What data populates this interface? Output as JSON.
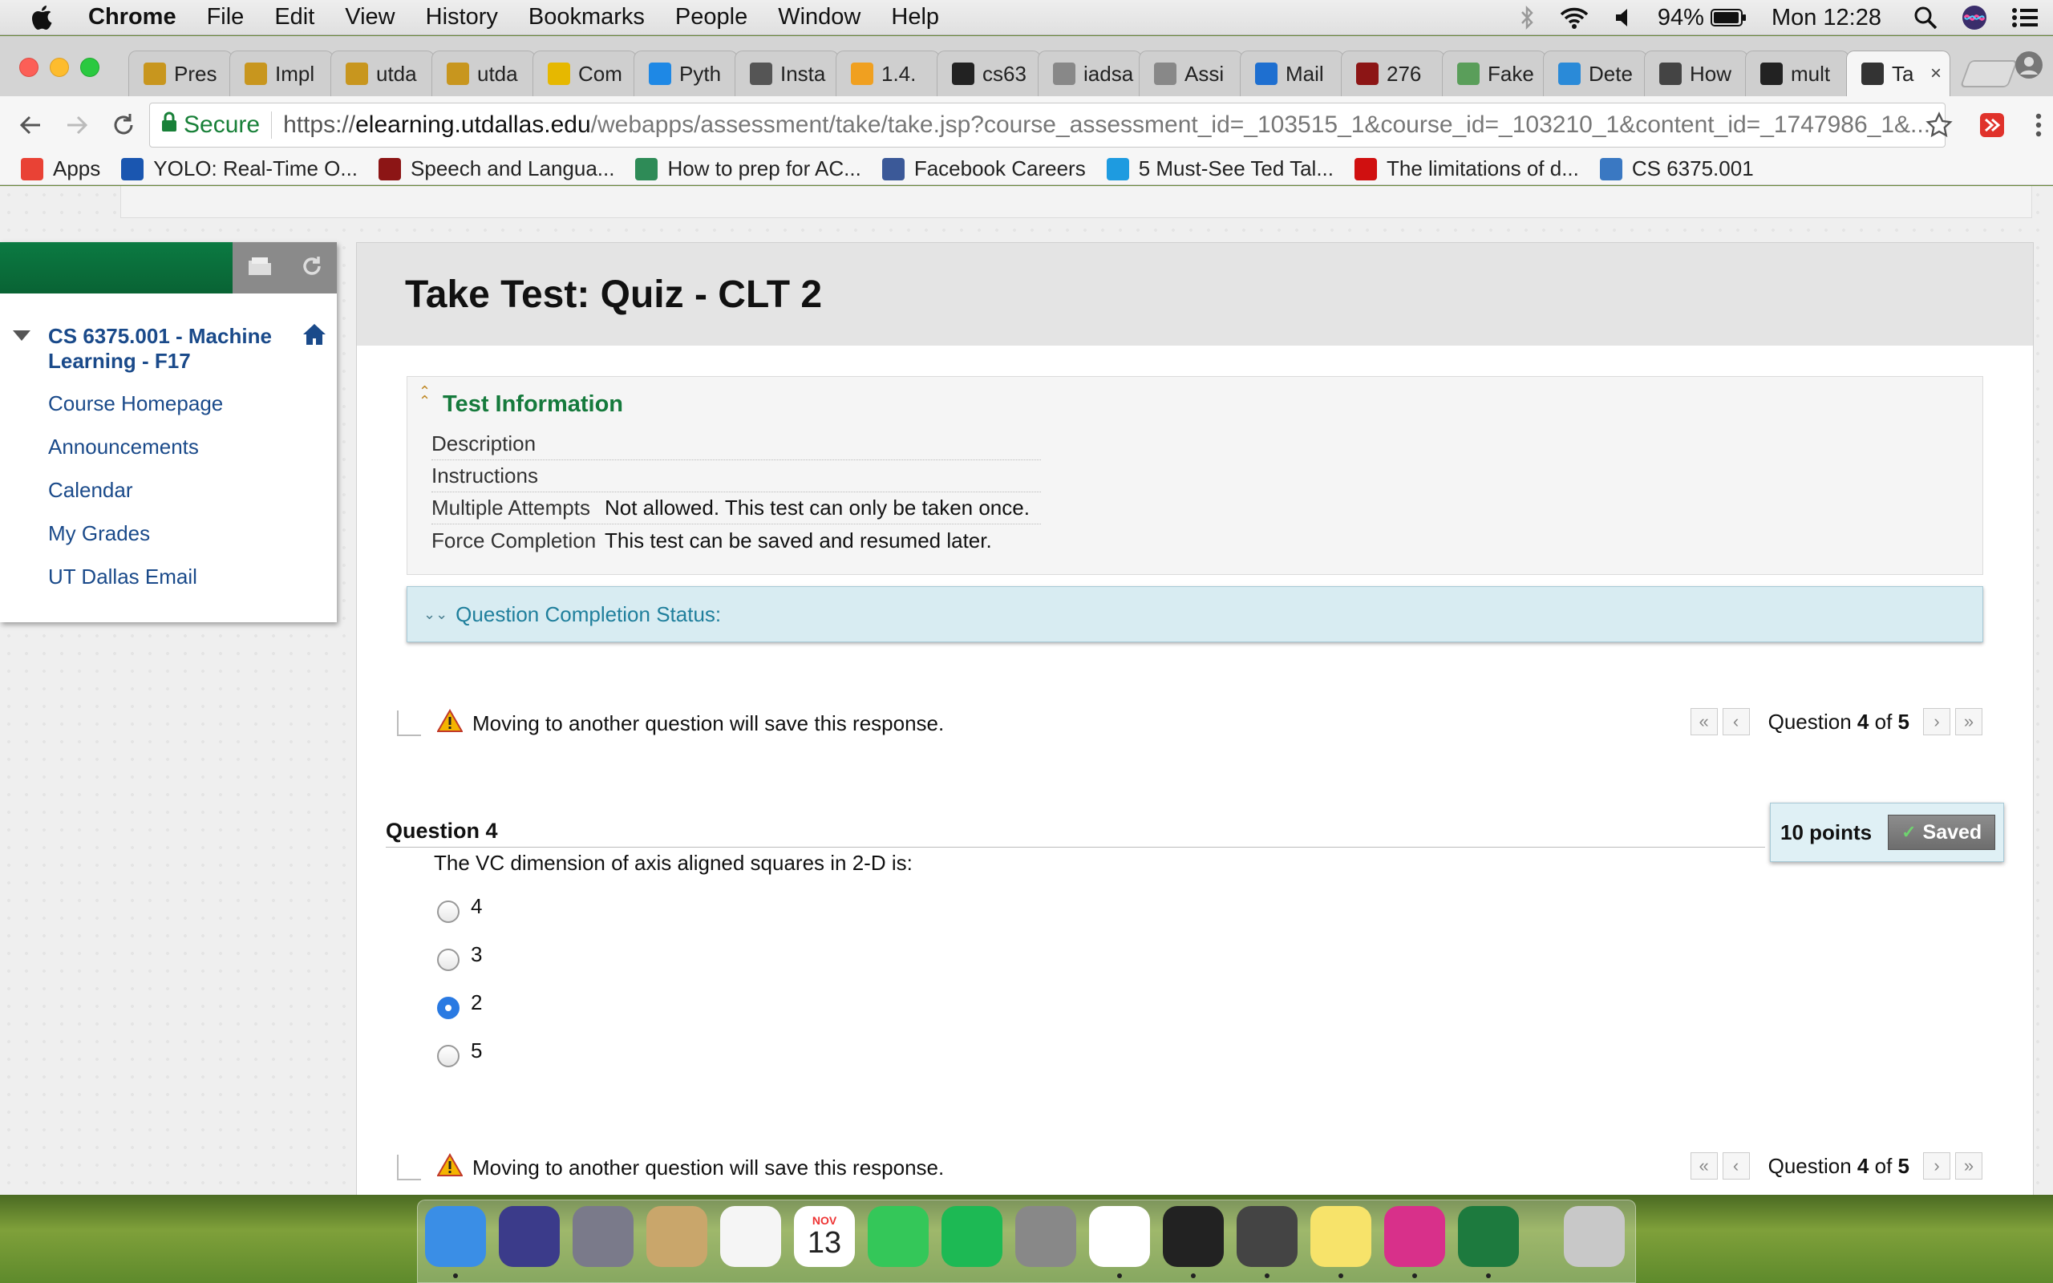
{
  "menubar": {
    "app": "Chrome",
    "items": [
      "File",
      "Edit",
      "View",
      "History",
      "Bookmarks",
      "People",
      "Window",
      "Help"
    ],
    "battery": "94%",
    "clock": "Mon 12:28"
  },
  "tabs": [
    {
      "label": "Pres",
      "icon": "utd-icon",
      "color": "#c8961e"
    },
    {
      "label": "Impl",
      "icon": "utd-icon",
      "color": "#c8961e"
    },
    {
      "label": "utda",
      "icon": "utd-icon",
      "color": "#c8961e"
    },
    {
      "label": "utda",
      "icon": "utd-icon",
      "color": "#c8961e"
    },
    {
      "label": "Com",
      "icon": "slides-icon",
      "color": "#e6b800"
    },
    {
      "label": "Pyth",
      "icon": "m-icon",
      "color": "#1e88e5"
    },
    {
      "label": "Insta",
      "icon": "doc-icon",
      "color": "#555555"
    },
    {
      "label": "1.4.",
      "icon": "chart-icon",
      "color": "#f0a020"
    },
    {
      "label": "cs63",
      "icon": "github-icon",
      "color": "#222222"
    },
    {
      "label": "iadsa",
      "icon": "page-icon",
      "color": "#888888"
    },
    {
      "label": "Assi",
      "icon": "page-icon",
      "color": "#888888"
    },
    {
      "label": "Mail",
      "icon": "outlook-icon",
      "color": "#1e6fd0"
    },
    {
      "label": "276",
      "icon": "stanford-icon",
      "color": "#8c1515"
    },
    {
      "label": "Fake",
      "icon": "money-icon",
      "color": "#5a9e5a"
    },
    {
      "label": "Dete",
      "icon": "shield-icon",
      "color": "#2a8ad8"
    },
    {
      "label": "How",
      "icon": "portrait-icon",
      "color": "#444444"
    },
    {
      "label": "mult",
      "icon": "github-icon",
      "color": "#222222"
    },
    {
      "label": "Ta",
      "icon": "bb-icon",
      "color": "#333333",
      "active": true
    }
  ],
  "toolbar": {
    "secure_label": "Secure",
    "url_scheme": "https://",
    "url_host": "elearning.utdallas.edu",
    "url_path": "/webapps/assessment/take/take.jsp?course_assessment_id=_103515_1&course_id=_103210_1&content_id=_1747986_1&..."
  },
  "bookmarks": [
    {
      "label": "Apps",
      "icon": "apps-icon",
      "color": "#e94235"
    },
    {
      "label": "YOLO: Real-Time O...",
      "icon": "p-icon",
      "color": "#1a56b0"
    },
    {
      "label": "Speech and Langua...",
      "icon": "stanford-icon",
      "color": "#8c1515"
    },
    {
      "label": "How to prep for AC...",
      "icon": "leaf-icon",
      "color": "#2e8b57"
    },
    {
      "label": "Facebook Careers",
      "icon": "facebook-icon",
      "color": "#3b5998"
    },
    {
      "label": "5 Must-See Ted Tal...",
      "icon": "cloud-icon",
      "color": "#1e9be0"
    },
    {
      "label": "The limitations of d...",
      "icon": "k-icon",
      "color": "#d01010"
    },
    {
      "label": "CS 6375.001",
      "icon": "piazza-icon",
      "color": "#3a78c2"
    }
  ],
  "sidebar": {
    "course": "CS 6375.001 - Machine Learning - F17",
    "links": [
      "Course Homepage",
      "Announcements",
      "Calendar",
      "My Grades",
      "UT Dallas Email"
    ]
  },
  "page": {
    "title": "Take Test: Quiz - CLT 2",
    "test_info_heading": "Test Information",
    "info_rows": [
      {
        "key": "Description",
        "value": ""
      },
      {
        "key": "Instructions",
        "value": ""
      },
      {
        "key": "Multiple Attempts",
        "value": "Not allowed. This test can only be taken once."
      },
      {
        "key": "Force Completion",
        "value": "This test can be saved and resumed later."
      }
    ],
    "completion_status": "Question Completion Status:",
    "save_warning": "Moving to another question will save this response.",
    "pager": {
      "prefix": "Question",
      "current": "4",
      "of": "of",
      "total": "5"
    },
    "question_heading": "Question 4",
    "points": "10 points",
    "saved_label": "Saved",
    "question_text": "The VC dimension of axis aligned squares in 2-D is:",
    "options": [
      {
        "label": "4",
        "selected": false
      },
      {
        "label": "3",
        "selected": false
      },
      {
        "label": "2",
        "selected": true
      },
      {
        "label": "5",
        "selected": false
      }
    ]
  },
  "dock": {
    "apps": [
      "finder-icon",
      "siri-icon",
      "launchpad-icon",
      "mail-icon",
      "photos-icon",
      "calendar-icon",
      "facetime-icon",
      "spotify-icon",
      "system-preferences-icon",
      "chrome-icon",
      "terminal-icon",
      "sublime-icon",
      "stickies-icon",
      "intellij-icon",
      "excel-icon",
      "trash-icon"
    ],
    "calendar_month": "NOV",
    "calendar_day": "13"
  }
}
